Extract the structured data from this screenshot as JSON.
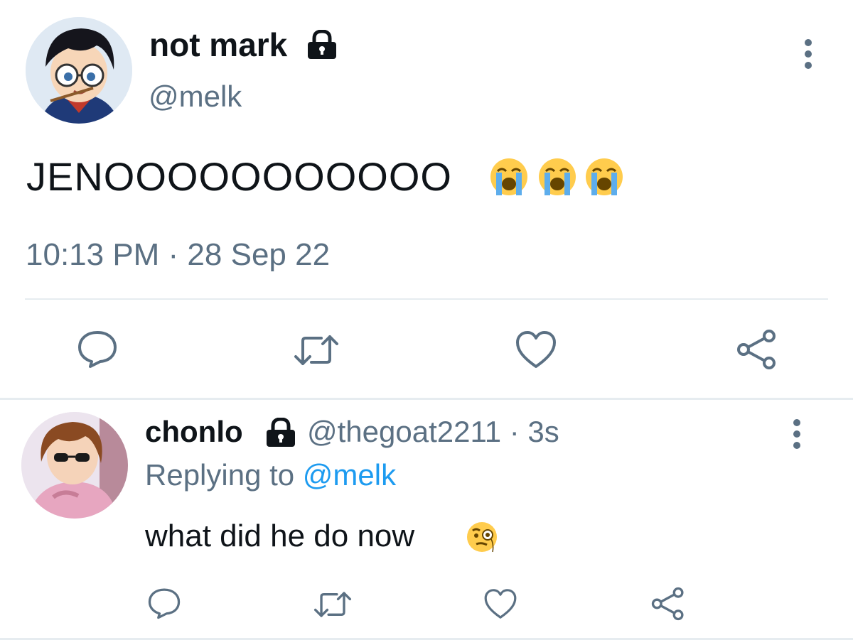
{
  "main_tweet": {
    "display_name": "not mark",
    "handle": "@melk",
    "text": "JENOOOOOOOOOOO",
    "emojis": [
      "loudly-crying-face",
      "loudly-crying-face",
      "loudly-crying-face"
    ],
    "timestamp": "10:13 PM · 28 Sep 22",
    "actions": [
      "reply",
      "retweet",
      "like",
      "share"
    ]
  },
  "reply_tweet": {
    "display_name": "chonlo",
    "handle": "@thegoat2211 · 3s",
    "replying_prefix": "Replying to",
    "replying_handle": "@melk",
    "text": "what did he do now",
    "emoji": "face-with-monocle",
    "actions": [
      "reply",
      "retweet",
      "like",
      "share"
    ]
  },
  "colors": {
    "text": "#0f1419",
    "muted": "#5b7083",
    "link": "#1d9bf0",
    "divider": "#e6ecf0"
  }
}
